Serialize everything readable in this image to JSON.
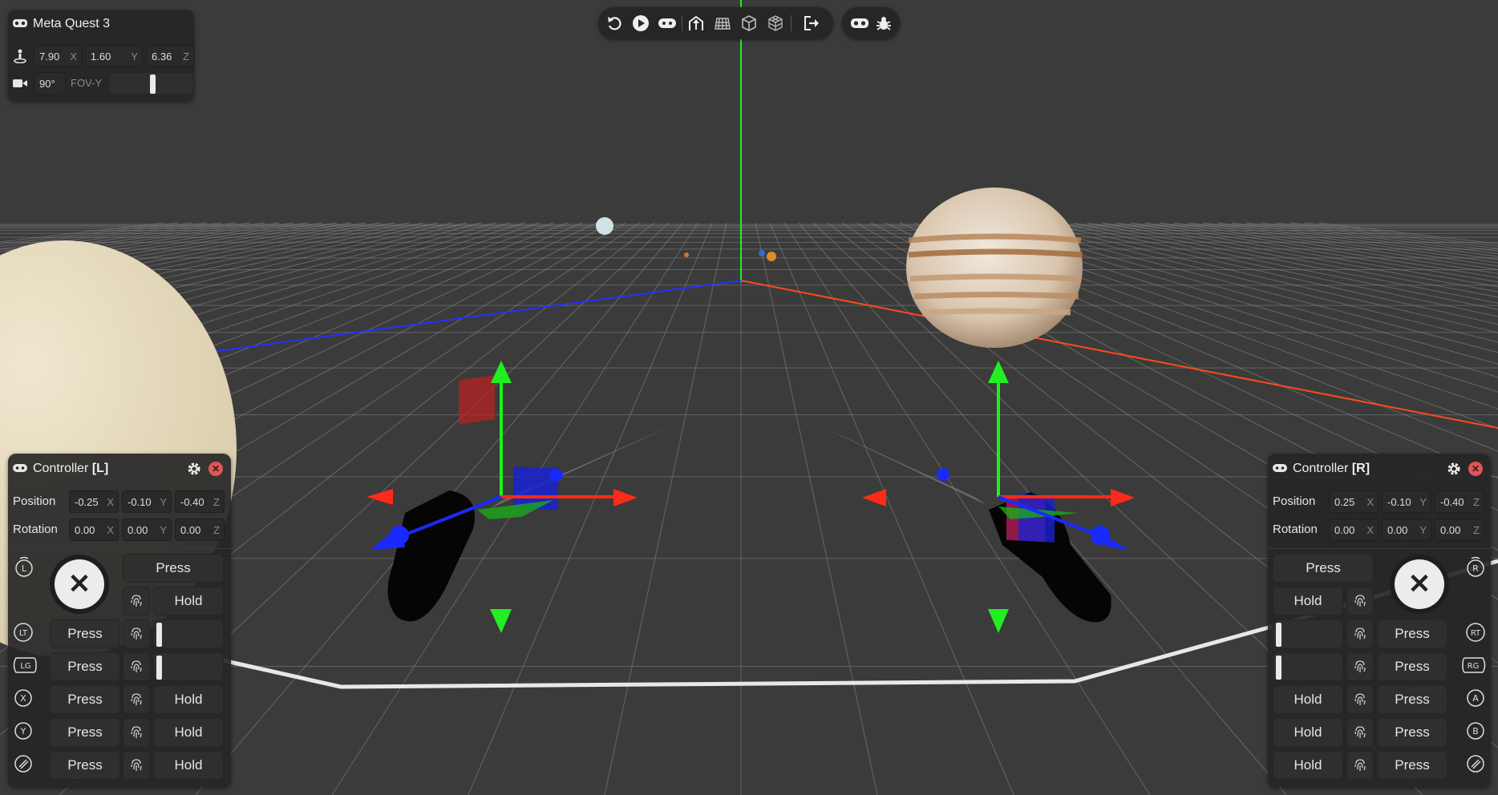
{
  "headset": {
    "title": "Meta Quest 3",
    "position": {
      "x": "7.90",
      "y": "1.60",
      "z": "6.36"
    },
    "fov_value": "90°",
    "fov_label": "FOV-Y",
    "fov_slider_level": 0.5
  },
  "toolbar": {
    "icons": [
      "undo-icon",
      "play-icon",
      "gamepad-icon",
      "room-setup-icon",
      "mesh-icon",
      "cube-icon",
      "grid-cube-icon",
      "exit-icon",
      "headset-icon",
      "bug-icon"
    ]
  },
  "axis_labels": {
    "x": "X",
    "y": "Y",
    "z": "Z"
  },
  "left_controller": {
    "title_prefix": "Controller ",
    "title_side": "[L]",
    "position_label": "Position",
    "rotation_label": "Rotation",
    "position": {
      "x": "-0.25",
      "y": "-0.10",
      "z": "-0.40"
    },
    "rotation": {
      "x": "0.00",
      "y": "0.00",
      "z": "0.00"
    },
    "joystick_symbol": "✕",
    "press_label": "Press",
    "hold_label": "Hold",
    "trigger_level": 0,
    "grip_level": 0
  },
  "right_controller": {
    "title_prefix": "Controller ",
    "title_side": "[R]",
    "position_label": "Position",
    "rotation_label": "Rotation",
    "position": {
      "x": "0.25",
      "y": "-0.10",
      "z": "-0.40"
    },
    "rotation": {
      "x": "0.00",
      "y": "0.00",
      "z": "0.00"
    },
    "joystick_symbol": "✕",
    "press_label": "Press",
    "hold_label": "Hold",
    "trigger_level": 0,
    "grip_level": 0
  },
  "button_glyphs": {
    "lt": "LT",
    "lg": "LG",
    "rt": "RT",
    "rg": "RG",
    "x": "X",
    "y": "Y",
    "a": "A",
    "b": "B",
    "l": "L",
    "r": "R"
  },
  "colors": {
    "x_axis": "#ff2a1a",
    "y_axis": "#22ee22",
    "z_axis": "#1a2aff",
    "background": "#3b3b3b",
    "panel": "#262626",
    "close": "#e05555"
  }
}
